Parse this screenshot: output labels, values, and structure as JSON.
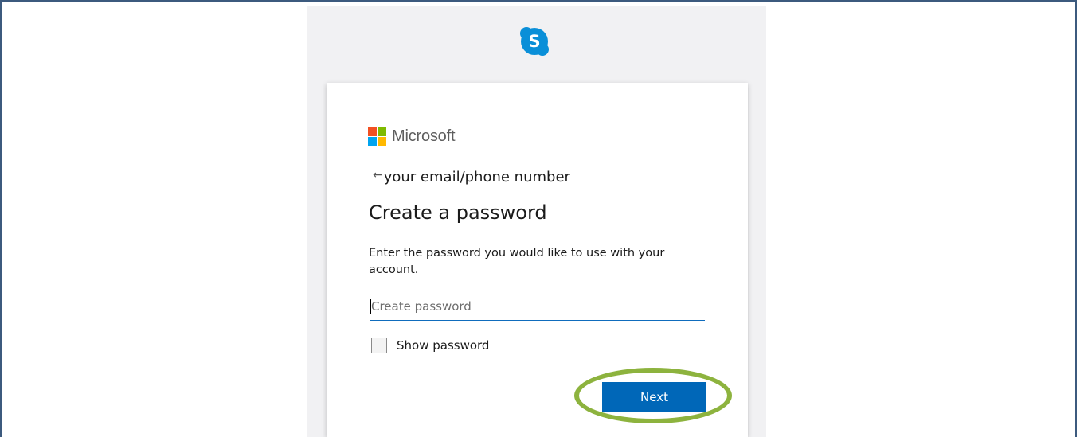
{
  "brand": {
    "product_icon": "skype-icon",
    "product_letter": "S",
    "company_name": "Microsoft",
    "logo_colors": [
      "#f25022",
      "#7fba00",
      "#00a4ef",
      "#ffb900"
    ],
    "accent": "#0067b8"
  },
  "header": {
    "back_icon": "arrow-left-icon",
    "back_symbol": "←",
    "identity_text": "your email/phone number"
  },
  "form": {
    "title": "Create a password",
    "description": "Enter the password you would like to use with your account.",
    "password": {
      "placeholder": "Create password",
      "value": ""
    },
    "show_password": {
      "label": "Show password",
      "checked": false
    },
    "next_label": "Next"
  },
  "annotation": {
    "highlight_color": "#8db33e",
    "target": "Next"
  }
}
